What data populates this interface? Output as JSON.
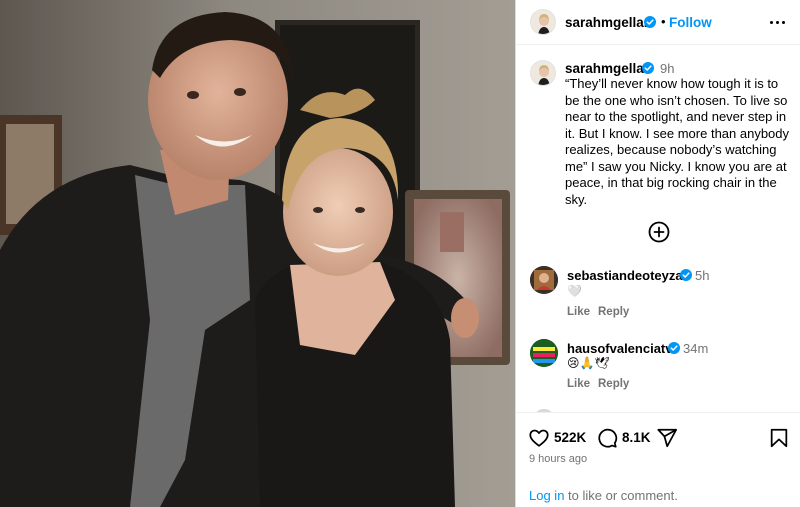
{
  "post": {
    "username": "sarahmgellar",
    "follow_label": "Follow",
    "separator": "•",
    "photo_alt": "Photo of two people smiling at an event"
  },
  "caption": {
    "username": "sarahmgellar",
    "time": "9h",
    "text": "“They’ll never know how tough it is to be the one who isn’t chosen. To live so near to the spotlight,  and never step in it. But I know. I see more than anybody realizes, because nobody’s watching me” I saw you Nicky. I know you are at peace, in that big rocking chair in the sky."
  },
  "comments": [
    {
      "username": "sebastiandeoteyza",
      "time": "5h",
      "text": "🤍",
      "like_label": "Like",
      "reply_label": "Reply"
    },
    {
      "username": "hausofvalenciatv",
      "time": "34m",
      "text": "😢🙏🕊",
      "like_label": "Like",
      "reply_label": "Reply"
    }
  ],
  "stats": {
    "likes": "522K",
    "comments": "8.1K",
    "time_ago": "9 hours ago"
  },
  "login": {
    "link_text": "Log in",
    "rest_text": " to like or comment."
  },
  "icons": {
    "verified": "verified-badge-icon",
    "more": "more-options-icon",
    "load_more": "add-circle-icon",
    "like": "heart-icon",
    "comment": "comment-icon",
    "share": "share-icon",
    "save": "bookmark-icon"
  },
  "colors": {
    "accent": "#0095f6",
    "verified": "#0095f6",
    "muted": "#737373"
  }
}
